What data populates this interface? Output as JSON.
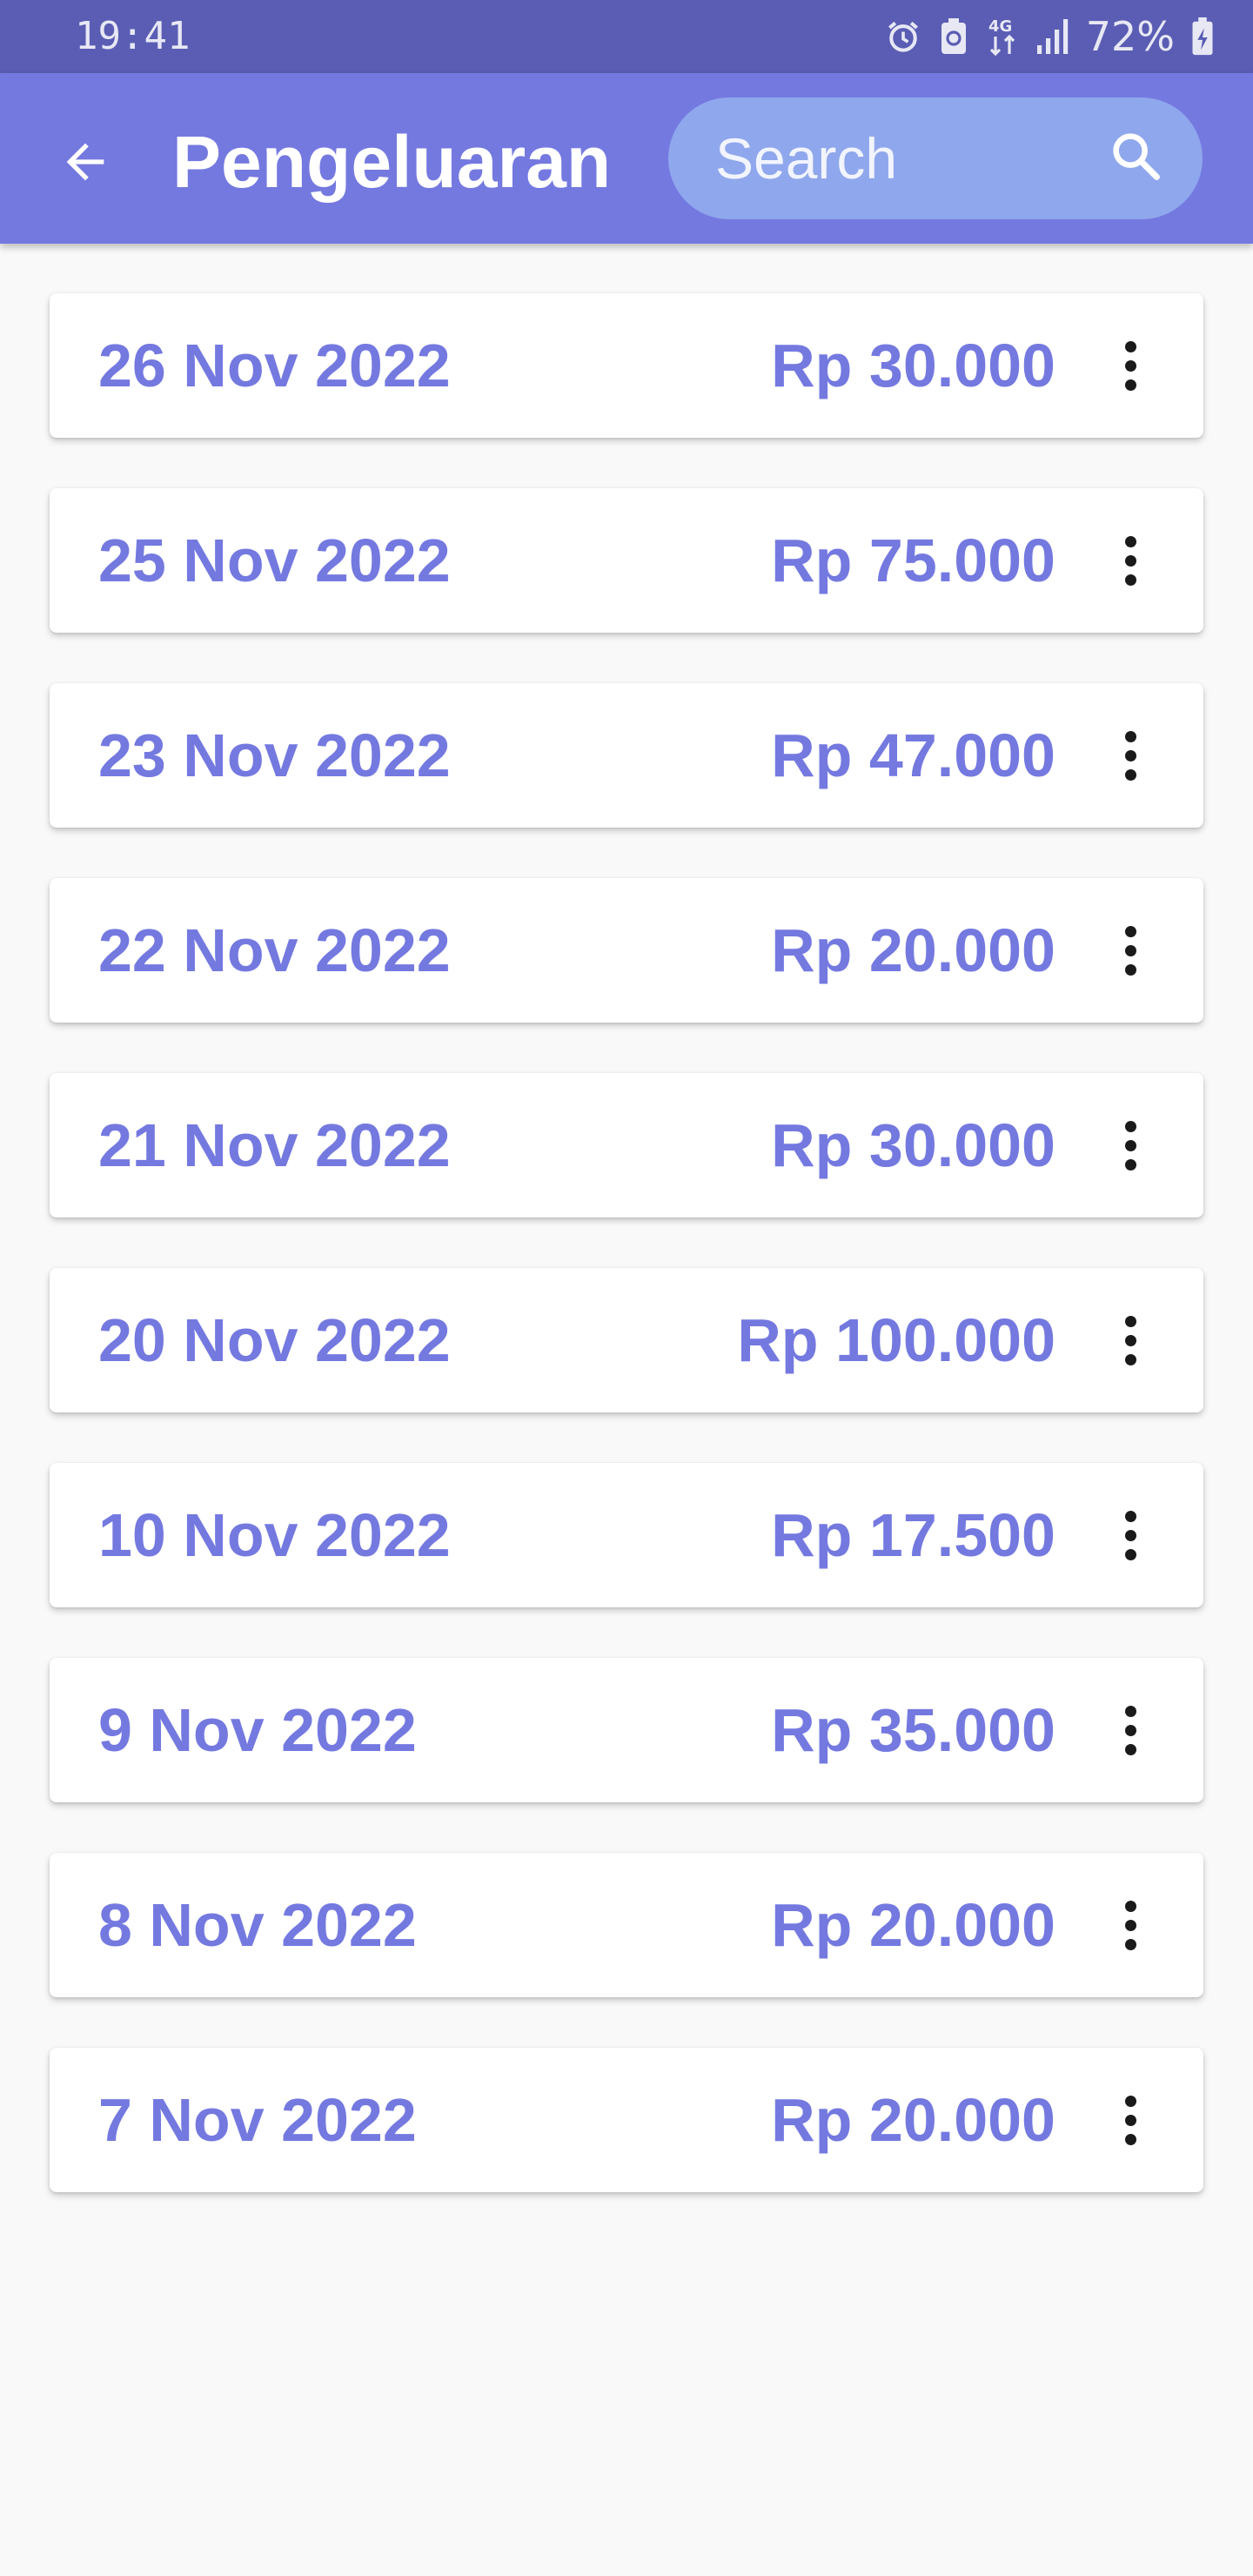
{
  "status_bar": {
    "time": "19:41",
    "network": "4G",
    "battery": "72%"
  },
  "app_bar": {
    "title": "Pengeluaran",
    "search_placeholder": "Search"
  },
  "expenses": [
    {
      "date": "26 Nov 2022",
      "amount": "Rp 30.000"
    },
    {
      "date": "25 Nov 2022",
      "amount": "Rp 75.000"
    },
    {
      "date": "23 Nov 2022",
      "amount": "Rp 47.000"
    },
    {
      "date": "22 Nov 2022",
      "amount": "Rp 20.000"
    },
    {
      "date": "21 Nov 2022",
      "amount": "Rp 30.000"
    },
    {
      "date": "20 Nov 2022",
      "amount": "Rp 100.000"
    },
    {
      "date": "10 Nov 2022",
      "amount": "Rp 17.500"
    },
    {
      "date": "9 Nov 2022",
      "amount": "Rp 35.000"
    },
    {
      "date": "8 Nov 2022",
      "amount": "Rp 20.000"
    },
    {
      "date": "7 Nov 2022",
      "amount": "Rp 20.000"
    }
  ],
  "colors": {
    "status_bar": "#5a5db3",
    "app_bar": "#7479e0",
    "search_box": "#8fa7ec",
    "accent_text": "#7479e0",
    "background": "#f9f9f9"
  },
  "icons": {
    "back": "arrow-left-icon",
    "search": "search-icon",
    "more": "more-vert-icon"
  }
}
